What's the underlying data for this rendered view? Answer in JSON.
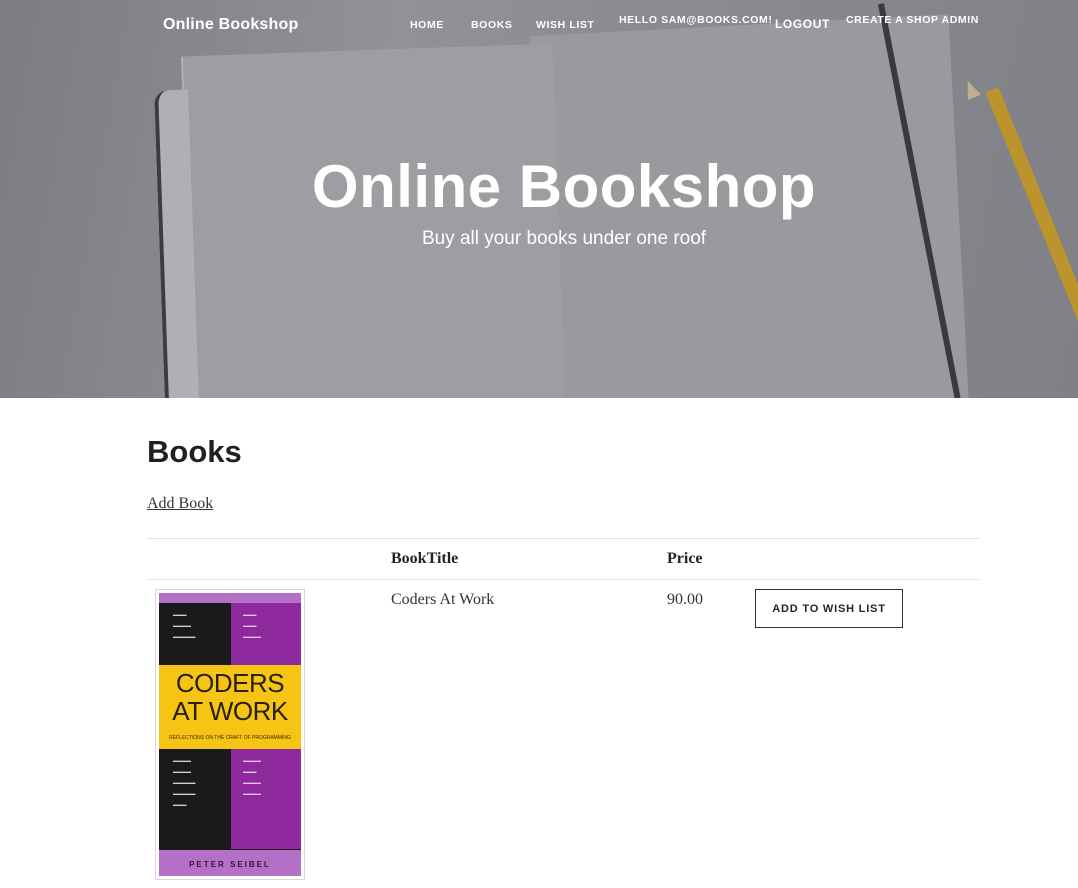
{
  "header": {
    "brand": "Online Bookshop",
    "nav": {
      "home": "HOME",
      "books": "BOOKS",
      "wishlist": "WISH LIST",
      "greeting": "HELLO SAM@BOOKS.COM!",
      "logout": "LOGOUT",
      "create_admin": "CREATE A SHOP ADMIN"
    }
  },
  "hero": {
    "title": "Online Bookshop",
    "subtitle": "Buy all your books under one roof"
  },
  "main": {
    "title": "Books",
    "add_link": "Add Book",
    "table": {
      "headers": [
        "",
        "BookTitle",
        "Price",
        ""
      ],
      "rows": [
        {
          "title": "Coders At Work",
          "price": "90.00",
          "action": "ADD TO WISH LIST",
          "cover": {
            "title_line1": "CODERS",
            "title_line2": "AT WORK",
            "tagline": "REFLECTIONS ON THE CRAFT OF PROGRAMMING",
            "author": "PETER SEIBEL"
          }
        }
      ]
    }
  },
  "colors": {
    "cover_yellow": "#f5c414",
    "cover_purple": "#8e2a9e",
    "text_dark": "#212529"
  }
}
